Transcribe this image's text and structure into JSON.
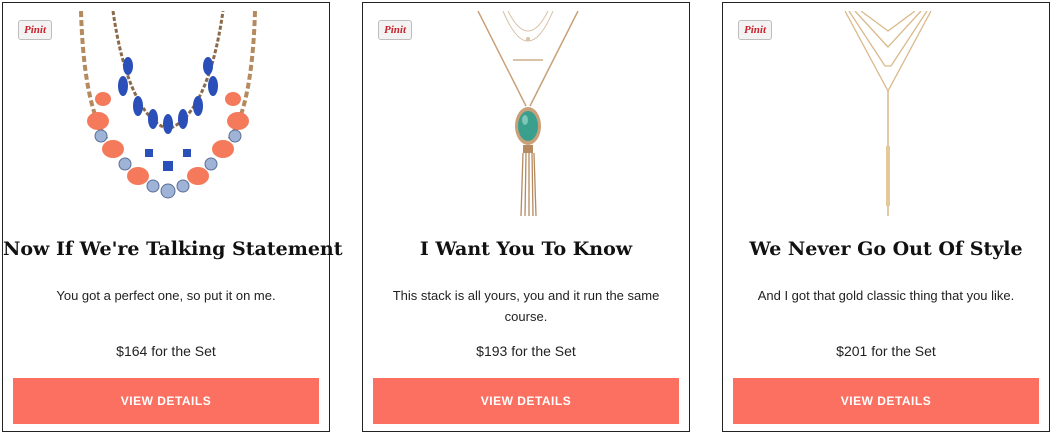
{
  "cards": [
    {
      "pin_label": "Pinit",
      "title": "Now If We're Talking Statement",
      "description": "You got a perfect one, so put it on me.",
      "price": "$164 for the Set",
      "button_label": "VIEW DETAILS"
    },
    {
      "pin_label": "Pinit",
      "title": "I Want You To Know",
      "description": "This stack is all yours, you and it run the same course.",
      "price": "$193 for the Set",
      "button_label": "VIEW DETAILS"
    },
    {
      "pin_label": "Pinit",
      "title": "We Never Go Out Of Style",
      "description": "And I got that gold classic thing that you like.",
      "price": "$201 for the Set",
      "button_label": "VIEW DETAILS"
    }
  ],
  "colors": {
    "button": "#fb7060",
    "card_border": "#222222",
    "pin_text": "#c8232c"
  },
  "icons": {
    "pin": "pinterest-pin-it-icon"
  }
}
